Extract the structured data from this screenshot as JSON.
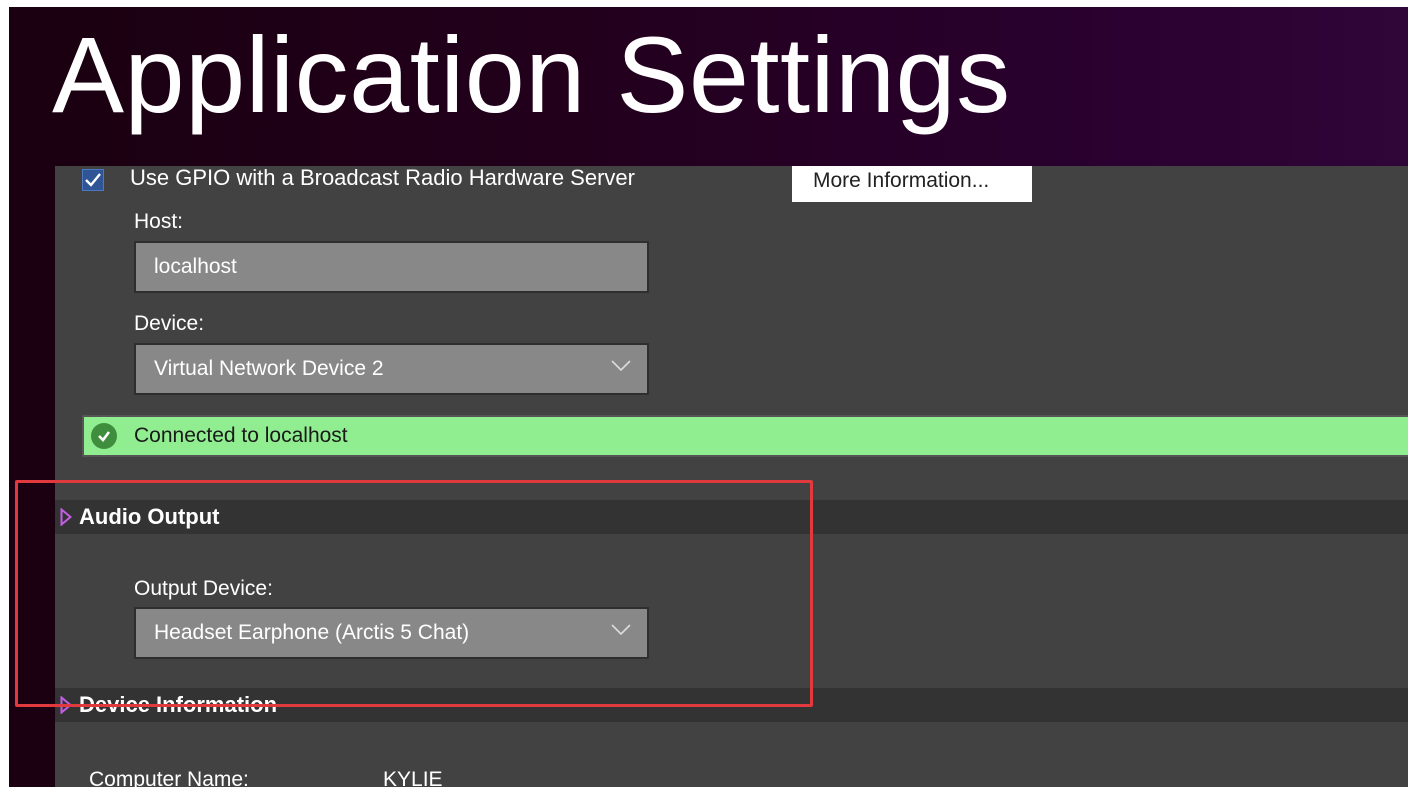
{
  "window": {
    "title": "Application Settings"
  },
  "gpio": {
    "checkbox_checked": true,
    "label": "Use GPIO with a Broadcast Radio Hardware Server",
    "more_info_label": "More Information..."
  },
  "host": {
    "label": "Host:",
    "value": "localhost"
  },
  "device": {
    "label": "Device:",
    "value": "Virtual Network Device 2"
  },
  "status": {
    "text": "Connected to localhost",
    "color": "#90ee90",
    "icon": "check-circle-icon"
  },
  "audio_output": {
    "title": "Audio Output",
    "output_device_label": "Output Device:",
    "output_device_value": "Headset Earphone (Arctis 5 Chat)"
  },
  "device_information": {
    "title": "Device Information",
    "computer_name_label": "Computer Name:",
    "computer_name_value": "KYLIE"
  },
  "colors": {
    "accent": "#b04fd6",
    "highlight": "#e0393e",
    "panel": "#424242"
  }
}
